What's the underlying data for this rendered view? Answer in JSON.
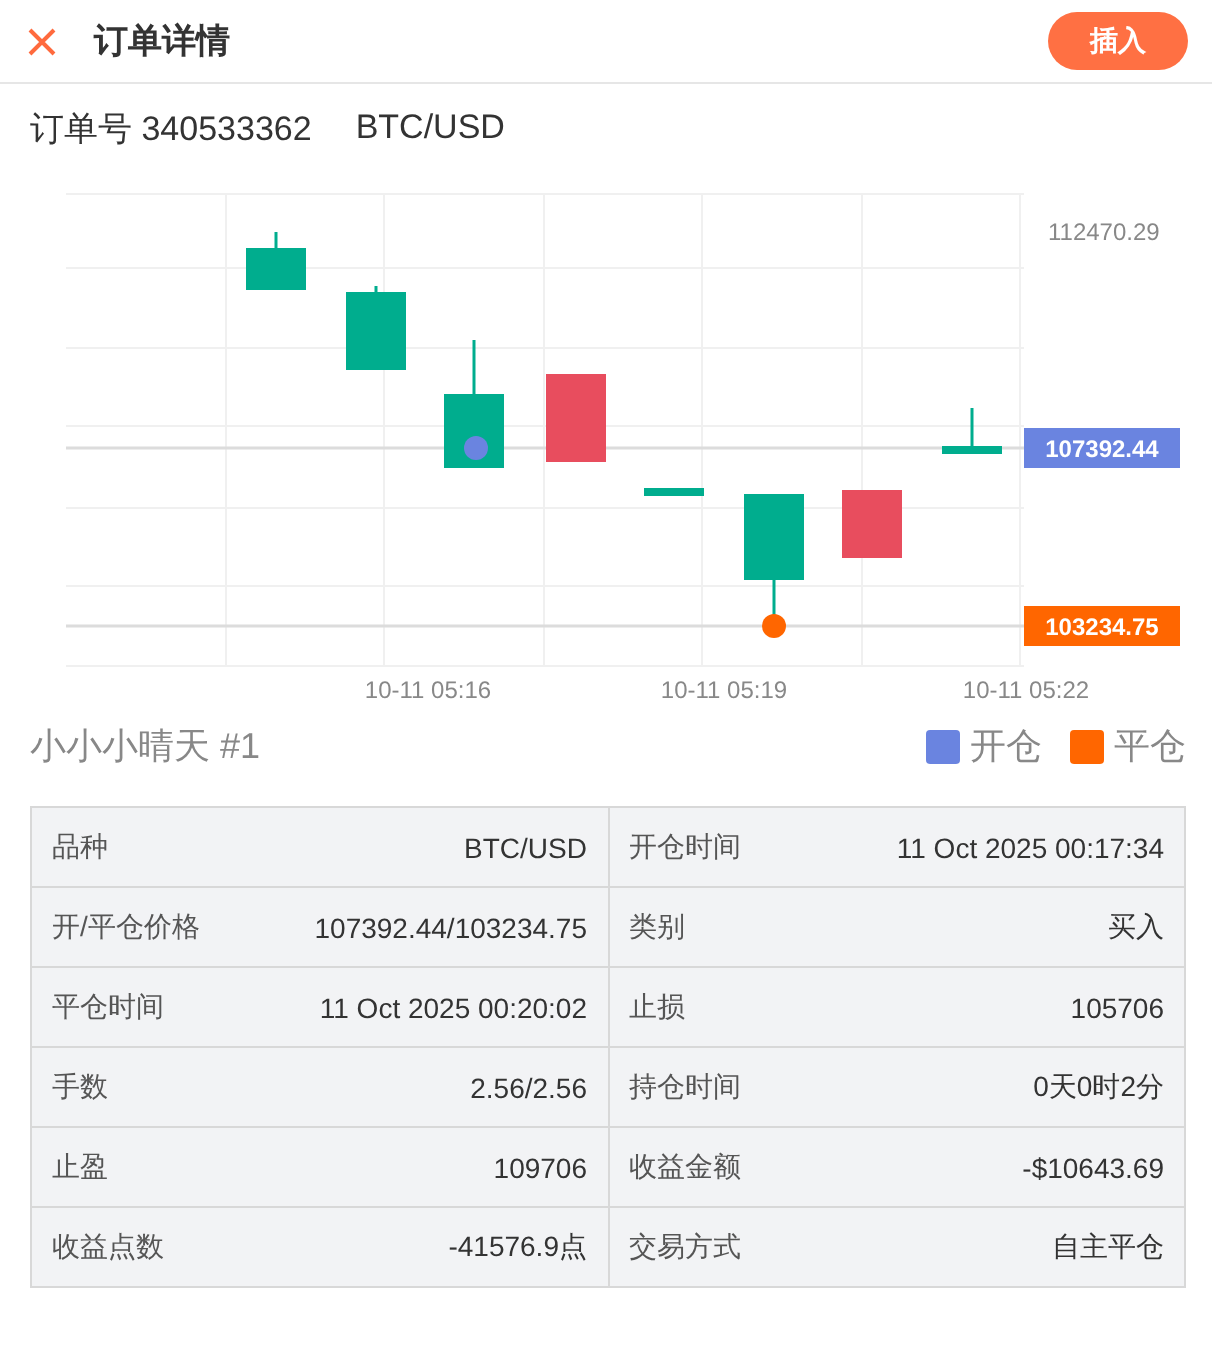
{
  "header": {
    "title": "订单详情",
    "action": "插入"
  },
  "order": {
    "number": "订单号 340533362",
    "symbol": "BTC/USD"
  },
  "chart": {
    "price_labels": [
      {
        "text": "112470.29",
        "kind": "axis"
      },
      {
        "text": "107392.44",
        "kind": "open"
      },
      {
        "text": "103234.75",
        "kind": "close"
      }
    ],
    "time_labels": [
      "10-11 05:16",
      "10-11 05:19",
      "10-11 05:22"
    ]
  },
  "account": "小小小晴天 #1",
  "legend": [
    {
      "label": "开仓",
      "color": "#6a84e0"
    },
    {
      "label": "平仓",
      "color": "#ff6600"
    }
  ],
  "details": [
    {
      "label": "品种",
      "value": "BTC/USD"
    },
    {
      "label": "开仓时间",
      "value": "11 Oct 2025 00:17:34"
    },
    {
      "label": "开/平仓价格",
      "value": "107392.44/103234.75"
    },
    {
      "label": "类别",
      "value": "买入"
    },
    {
      "label": "平仓时间",
      "value": "11 Oct 2025 00:20:02"
    },
    {
      "label": "止损",
      "value": "105706"
    },
    {
      "label": "手数",
      "value": "2.56/2.56"
    },
    {
      "label": "持仓时间",
      "value": "0天0时2分"
    },
    {
      "label": "止盈",
      "value": "109706"
    },
    {
      "label": "收益金额",
      "value": "-$10643.69"
    },
    {
      "label": "收益点数",
      "value": "-41576.9点"
    },
    {
      "label": "交易方式",
      "value": "自主平仓"
    }
  ]
}
